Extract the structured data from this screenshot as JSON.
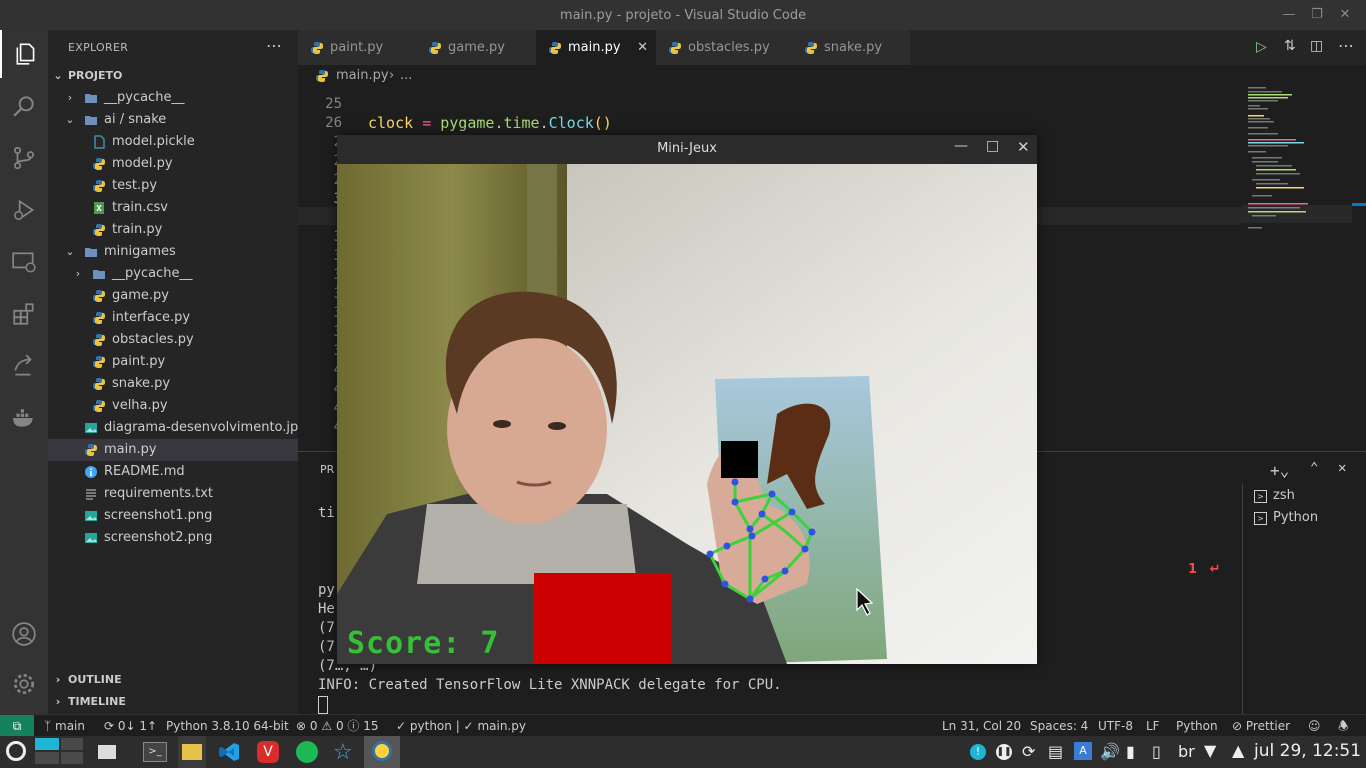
{
  "window": {
    "title": "main.py - projeto - Visual Studio Code"
  },
  "activity_bar": [
    "explorer-icon",
    "search-icon",
    "source-control-icon",
    "run-debug-icon",
    "remote-explorer-icon",
    "extensions-icon",
    "live-share-icon",
    "docker-icon",
    "account-icon",
    "settings-gear-icon"
  ],
  "sidebar": {
    "header": "EXPLORER",
    "root": "PROJETO",
    "items": [
      {
        "label": "__pycache__",
        "type": "folder",
        "level": 1,
        "expanded": false
      },
      {
        "label": "ai / snake",
        "type": "folder",
        "level": 1,
        "expanded": true
      },
      {
        "label": "model.pickle",
        "type": "file",
        "level": 2
      },
      {
        "label": "model.py",
        "type": "py",
        "level": 2
      },
      {
        "label": "test.py",
        "type": "py",
        "level": 2
      },
      {
        "label": "train.csv",
        "type": "csv",
        "level": 2
      },
      {
        "label": "train.py",
        "type": "py",
        "level": 2
      },
      {
        "label": "minigames",
        "type": "folder",
        "level": 1,
        "expanded": true
      },
      {
        "label": "__pycache__",
        "type": "folder",
        "level": 2,
        "expanded": false
      },
      {
        "label": "game.py",
        "type": "py",
        "level": 2
      },
      {
        "label": "interface.py",
        "type": "py",
        "level": 2
      },
      {
        "label": "obstacles.py",
        "type": "py",
        "level": 2
      },
      {
        "label": "paint.py",
        "type": "py",
        "level": 2
      },
      {
        "label": "snake.py",
        "type": "py",
        "level": 2
      },
      {
        "label": "velha.py",
        "type": "py",
        "level": 2
      },
      {
        "label": "diagrama-desenvolvimento.jpg",
        "type": "img",
        "level": 1
      },
      {
        "label": "main.py",
        "type": "py",
        "level": 1,
        "selected": true
      },
      {
        "label": "README.md",
        "type": "info",
        "level": 1
      },
      {
        "label": "requirements.txt",
        "type": "txt",
        "level": 1
      },
      {
        "label": "screenshot1.png",
        "type": "img",
        "level": 1
      },
      {
        "label": "screenshot2.png",
        "type": "img",
        "level": 1
      }
    ],
    "outline": "OUTLINE",
    "timeline": "TIMELINE"
  },
  "tabs": [
    {
      "label": "paint.py",
      "active": false
    },
    {
      "label": "game.py",
      "active": false
    },
    {
      "label": "main.py",
      "active": true
    },
    {
      "label": "obstacles.py",
      "active": false
    },
    {
      "label": "snake.py",
      "active": false
    }
  ],
  "breadcrumb": {
    "file": "main.py",
    "rest": "..."
  },
  "editor": {
    "line_numbers": [
      "25",
      "26",
      "2",
      "2",
      "2",
      "3",
      "3",
      "3",
      "3",
      "3",
      "3",
      "3",
      "3",
      "3",
      "4",
      "4",
      "4",
      "4"
    ],
    "code_line_26": {
      "var": "clock",
      "op": "=",
      "mod": "pygame",
      "attr": "time",
      "cls": "Clock",
      "paren": "()"
    }
  },
  "panel": {
    "tab_fragment": "PR",
    "terminal_lines": [
      "ti",
      "",
      "py",
      "He",
      "(7",
      "(7",
      "(7…, …)",
      "INFO: Created TensorFlow Lite XNNPACK delegate for CPU."
    ],
    "terminals": [
      "zsh",
      "Python"
    ],
    "problem_count": "1",
    "problem_symbol": "↵"
  },
  "game_window": {
    "title": "Mini-Jeux",
    "score_label": "Score: 7"
  },
  "statusbar": {
    "branch": "main",
    "sync": "0↓ 1↑",
    "interpreter": "Python 3.8.10 64-bit",
    "errors": "0",
    "warnings": "0",
    "infos": "15",
    "check1": "python",
    "check2": "main.py",
    "position": "Ln 31, Col 20",
    "spaces": "Spaces: 4",
    "encoding": "UTF-8",
    "eol": "LF",
    "language": "Python",
    "formatter": "Prettier"
  },
  "taskbar": {
    "lang": "br",
    "clock": "jul 29, 12:51"
  },
  "colors": {
    "accent": "#007acc",
    "score_green": "#36c036",
    "red_block": "#cc0000",
    "python_blue": "#3572A5",
    "python_yellow": "#ffd43b"
  }
}
